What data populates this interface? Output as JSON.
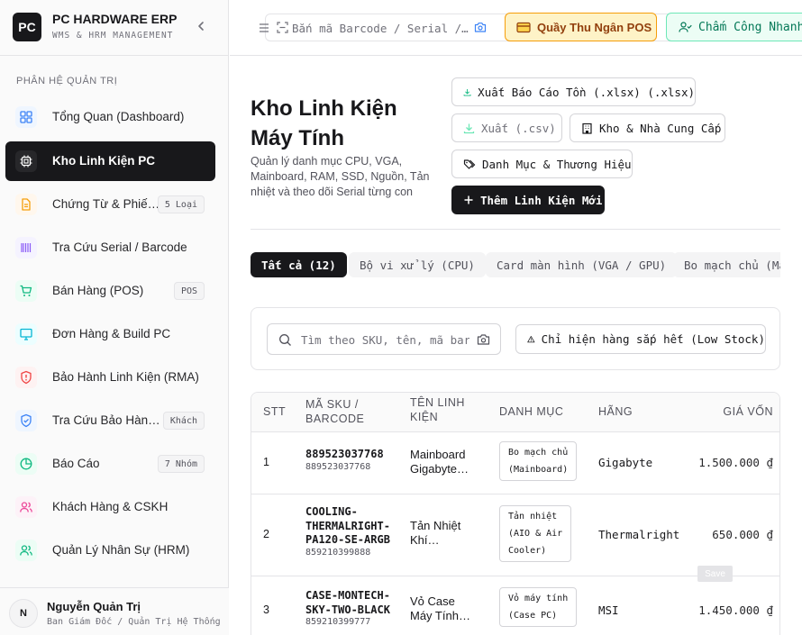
{
  "brand": {
    "logo": "PC",
    "title": "PC HARDWARE ERP",
    "subtitle": "WMS & HRM MANAGEMENT"
  },
  "sidebar": {
    "section_label": "PHÂN HỆ QUẢN TRỊ",
    "items": [
      {
        "label": "Tổng Quan (Dashboard)",
        "icon": "dashboard-icon",
        "badge": ""
      },
      {
        "label": "Kho Linh Kiện PC",
        "icon": "cpu-chip-icon",
        "badge": "",
        "active": true
      },
      {
        "label": "Chứng Từ & Phiếu Kho",
        "icon": "document-icon",
        "badge": "5 Loại"
      },
      {
        "label": "Tra Cứu Serial / Barcode",
        "icon": "barcode-icon",
        "badge": ""
      },
      {
        "label": "Bán Hàng (POS)",
        "icon": "shopping-cart-icon",
        "badge": "POS"
      },
      {
        "label": "Đơn Hàng & Build PC",
        "icon": "monitor-icon",
        "badge": ""
      },
      {
        "label": "Bảo Hành Linh Kiện (RMA)",
        "icon": "shield-alert-icon",
        "badge": ""
      },
      {
        "label": "Tra Cứu Bảo Hành Khách",
        "icon": "shield-check-icon",
        "badge": "Khách"
      },
      {
        "label": "Báo Cáo",
        "icon": "pie-chart-icon",
        "badge": "7 Nhóm"
      },
      {
        "label": "Khách Hàng & CSKH",
        "icon": "users-icon",
        "badge": ""
      },
      {
        "label": "Quản Lý Nhân Sự (HRM)",
        "icon": "staff-icon",
        "badge": ""
      }
    ]
  },
  "user": {
    "initial": "N",
    "name": "Nguyễn Quản Trị",
    "role": "Ban Giám Đốc / Quản Trị Hệ Thống"
  },
  "header": {
    "search_placeholder": "Bắn mã Barcode / Serial / SKU...",
    "pos_label": "Quầy Thu Ngân POS",
    "attendance_label": "Chấm Công Nhanh"
  },
  "page": {
    "title": "Kho Linh Kiện Máy Tính",
    "description": "Quản lý danh mục CPU, VGA, Mainboard, RAM, SSD, Nguồn, Tản nhiệt và theo dõi Serial từng con",
    "actions": {
      "export_xlsx": "Xuất Báo Cáo Tồn (.xlsx) (.xlsx)",
      "export_csv": "Xuất (.csv)",
      "warehouse_suppliers": "Kho & Nhà Cung Cấp",
      "categories_brands": "Danh Mục & Thương Hiệu",
      "add_new": "Thêm Linh Kiện Mới"
    }
  },
  "tabs": [
    "Tất cả (12)",
    "Bộ vi xử lý (CPU)",
    "Card màn hình (VGA / GPU)",
    "Bo mạch chủ (Mainboard)"
  ],
  "filter": {
    "search_placeholder": "Tìm theo SKU, tên, mã barcode...",
    "low_stock_label": "Chỉ hiện hàng sắp hết (Low Stock)"
  },
  "table": {
    "columns": {
      "stt": "STT",
      "sku_line1": "MÃ SKU /",
      "sku_line2": "BARCODE",
      "name_line1": "TÊN LINH",
      "name_line2": "KIỆN",
      "category": "DANH MỤC",
      "brand": "HÃNG",
      "cost": "GIÁ VỐN"
    },
    "rows": [
      {
        "stt": "1",
        "sku": [
          "889523037768"
        ],
        "barcode": "889523037768",
        "name": [
          "Mainboard",
          "Gigabyte…"
        ],
        "category": [
          "Bo mạch chủ",
          "(Mainboard)"
        ],
        "brand": "Gigabyte",
        "cost": "1.500.000 ₫"
      },
      {
        "stt": "2",
        "sku": [
          "COOLING-",
          "THERMALRIGHT-",
          "PA120-SE-ARGB"
        ],
        "barcode": "859210399888",
        "name": [
          "Tản Nhiệt",
          "Khí…"
        ],
        "category": [
          "Tản nhiệt",
          "(AIO & Air",
          "Cooler)"
        ],
        "brand": "Thermalright",
        "cost": "650.000 ₫"
      },
      {
        "stt": "3",
        "sku": [
          "CASE-MONTECH-",
          "SKY-TWO-BLACK"
        ],
        "barcode": "859210399777",
        "name": [
          "Vỏ Case",
          "Máy Tính…"
        ],
        "category": [
          "Vỏ máy tính",
          "(Case PC)"
        ],
        "brand": "MSI",
        "cost": "1.450.000 ₫"
      }
    ]
  },
  "tooltip": "Save"
}
